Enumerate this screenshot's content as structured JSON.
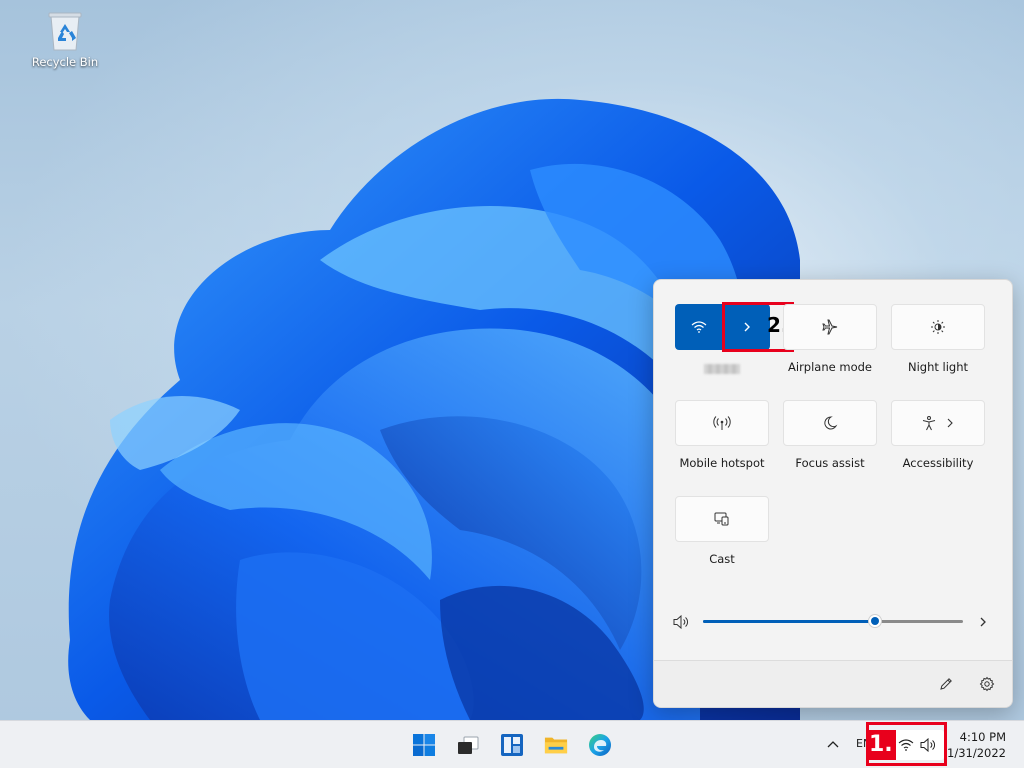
{
  "desktop": {
    "recycle_bin_label": "Recycle Bin"
  },
  "quick_settings": {
    "wifi": {
      "state": "on",
      "ssid_label": "",
      "expand_icon": "chevron-right-icon"
    },
    "tiles": [
      {
        "id": "airplane",
        "label": "Airplane mode",
        "icon": "airplane-icon",
        "active": false
      },
      {
        "id": "night-light",
        "label": "Night light",
        "icon": "brightness-icon",
        "active": false
      },
      {
        "id": "mobile-hotspot",
        "label": "Mobile hotspot",
        "icon": "hotspot-icon",
        "active": false
      },
      {
        "id": "focus-assist",
        "label": "Focus assist",
        "icon": "moon-icon",
        "active": false
      },
      {
        "id": "accessibility",
        "label": "Accessibility",
        "icon": "accessibility-icon",
        "active": false
      },
      {
        "id": "cast",
        "label": "Cast",
        "icon": "cast-icon",
        "active": false
      }
    ],
    "volume": {
      "level_percent": 66,
      "icon": "speaker-icon"
    },
    "footer": {
      "edit_icon": "pencil-icon",
      "settings_icon": "gear-icon"
    }
  },
  "annotations": {
    "step1": "1.",
    "step2": "2."
  },
  "taskbar": {
    "pinned": [
      "start-icon",
      "task-view-icon",
      "widgets-icon",
      "file-explorer-icon",
      "edge-icon"
    ],
    "tray": {
      "overflow_icon": "chevron-up-icon",
      "language": "ENG",
      "network_icon": "wifi-icon",
      "volume_icon": "speaker-icon"
    },
    "clock": {
      "time": "4:10 PM",
      "date": "1/31/2022"
    }
  },
  "colors": {
    "accent": "#005fb8",
    "annotation": "#e8001c",
    "panel_bg": "#f3f3f3",
    "taskbar_bg": "#eef0f3"
  }
}
